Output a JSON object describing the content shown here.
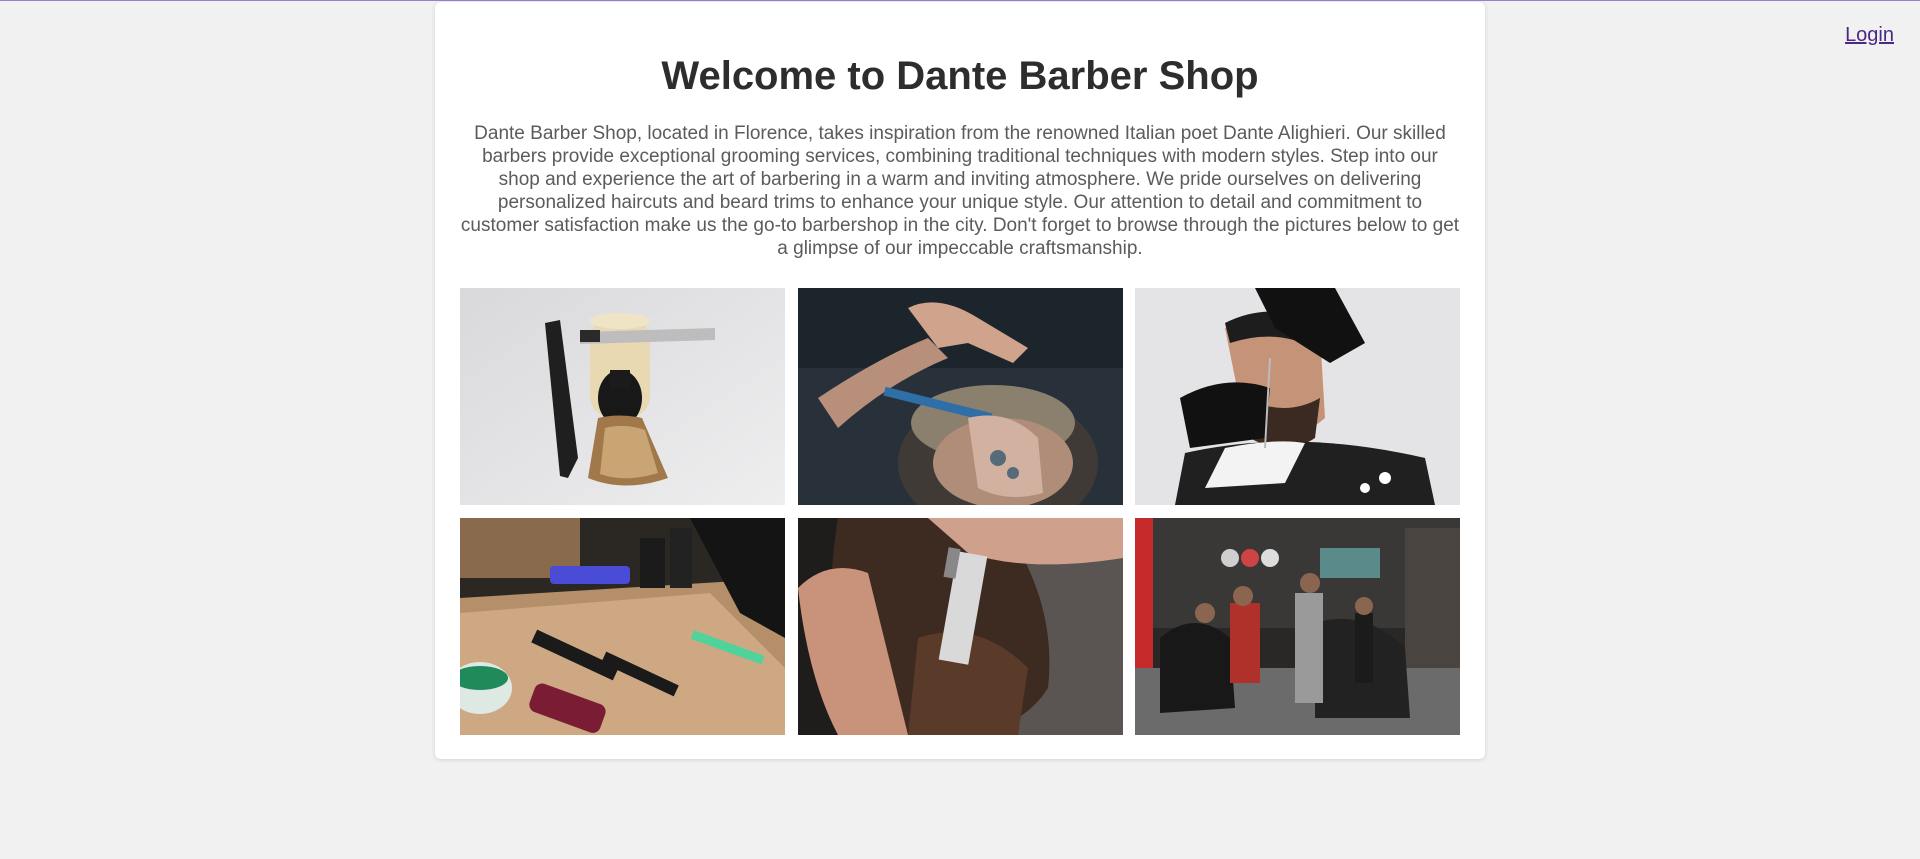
{
  "header": {
    "login_label": "Login"
  },
  "main": {
    "title": "Welcome to Dante Barber Shop",
    "intro": "Dante Barber Shop, located in Florence, takes inspiration from the renowned Italian poet Dante Alighieri. Our skilled barbers provide exceptional grooming services, combining traditional techniques with modern styles. Step into our shop and experience the art of barbering in a warm and inviting atmosphere. We pride ourselves on delivering personalized haircuts and beard trims to enhance your unique style. Our attention to detail and commitment to customer satisfaction make us the go-to barbershop in the city. Don't forget to browse through the pictures below to get a glimpse of our impeccable craftsmanship."
  },
  "colors": {
    "page_background": "#f1f1f1",
    "card_background": "#ffffff",
    "title": "#2d2d2d",
    "body_text": "#5b5b5b",
    "link": "#4b2a86"
  }
}
